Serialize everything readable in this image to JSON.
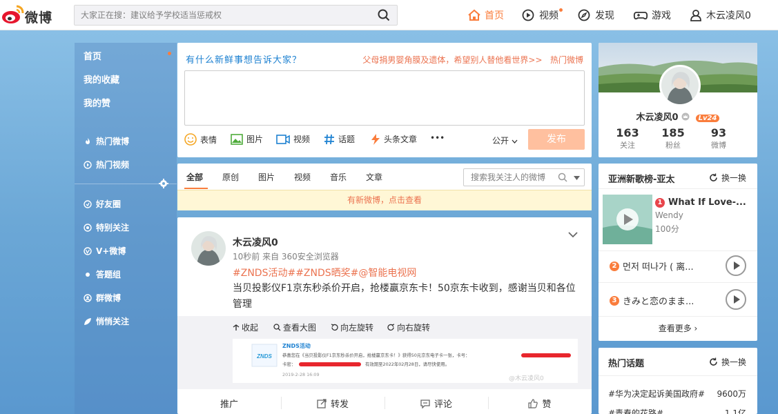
{
  "header": {
    "logo_text": "微博",
    "search_placeholder": "大家正在搜：建议给予学校适当惩戒权",
    "nav": {
      "home": "首页",
      "video": "视频",
      "discover": "发现",
      "games": "游戏",
      "user": "木云凌风0"
    }
  },
  "sidebar": {
    "top": [
      "首页",
      "我的收藏",
      "我的赞"
    ],
    "hot": [
      "热门微博",
      "热门视频"
    ],
    "groups": [
      "好友圈",
      "特别关注",
      "V+微博",
      "答题组",
      "群微博",
      "悄悄关注"
    ]
  },
  "composer": {
    "title": "有什么新鲜事想告诉大家？",
    "hot_topic": "父母捐男婴角膜及遗体，希望别人替他看世界>>",
    "hot_link": "热门微博",
    "tools": [
      "表情",
      "图片",
      "视频",
      "话题",
      "头条文章"
    ],
    "more": "•••",
    "visibility": "公开",
    "publish": "发布"
  },
  "feed_tabs": {
    "tabs": [
      "全部",
      "原创",
      "图片",
      "视频",
      "音乐",
      "文章"
    ],
    "search_placeholder": "搜索我关注人的微博",
    "new_notice": "有新微博，点击查看"
  },
  "post": {
    "author": "木云凌风0",
    "meta": "10秒前 来自 360安全浏览器",
    "tags": "#ZNDS活动##ZNDS晒奖#@智能电视网",
    "text": "当贝投影仪F1京东秒杀价开启，抢楼赢京东卡！50京东卡收到，感谢当贝和各位管理",
    "media_actions": [
      "收起",
      "查看大图",
      "向左旋转",
      "向右旋转"
    ],
    "image": {
      "brand": "ZNDS活动",
      "body": "恭喜您在《当贝投影仪F1京东秒杀价开启，抢楼赢京东卡！》获得50元京东电子卡一张，卡号：",
      "body2": "卡密：",
      "body3": "有效期至2022年02月28日，请尽快使用。",
      "date": "2019-2-28 16:09",
      "watermark": "@木云凌风0"
    },
    "actions": [
      "推广",
      "转发",
      "评论",
      "赞"
    ]
  },
  "profile": {
    "name": "木云凌风0",
    "level": "Lv24",
    "stats": [
      {
        "num": "163",
        "label": "关注"
      },
      {
        "num": "185",
        "label": "粉丝"
      },
      {
        "num": "93",
        "label": "微博"
      }
    ]
  },
  "music": {
    "title": "亚洲新歌榜-亚太",
    "refresh": "换一换",
    "songs": [
      {
        "rank": "1",
        "name": "What If Love-...",
        "artist": "Wendy",
        "score": "100分"
      },
      {
        "rank": "2",
        "name": "먼저 떠나가 ( 离..."
      },
      {
        "rank": "3",
        "name": "きみと恋のまま..."
      }
    ],
    "more": "查看更多 ›"
  },
  "hot_topics": {
    "title": "热门话题",
    "refresh": "换一换",
    "items": [
      {
        "name": "#华为决定起诉美国政府#",
        "count": "9600万"
      },
      {
        "name": "#青春的花路#",
        "count": "1.1亿"
      }
    ]
  },
  "colors": {
    "accent": "#fa7d3c",
    "link_blue": "#1d81d1",
    "hot_red": "#eb7350"
  }
}
